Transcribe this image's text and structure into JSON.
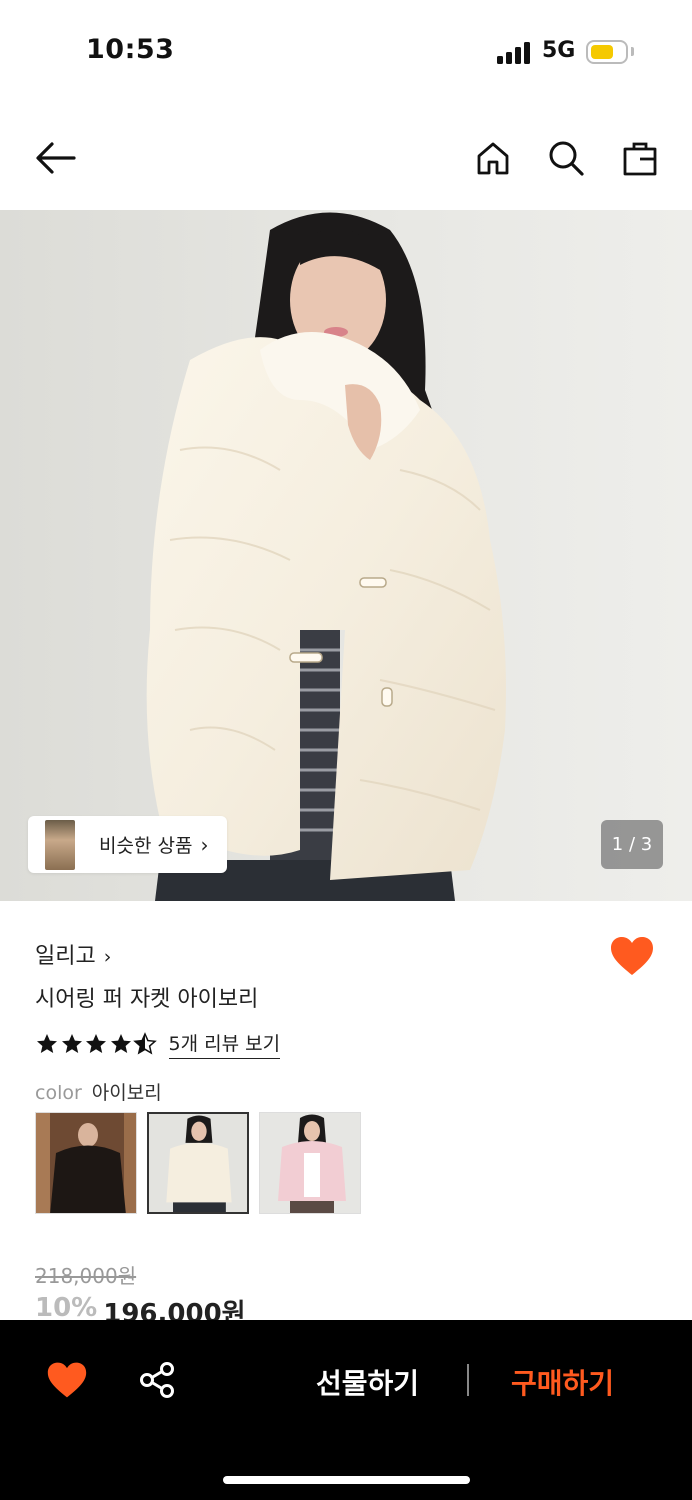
{
  "status_bar": {
    "time": "10:53",
    "network": "5G"
  },
  "nav": {
    "back_icon": "arrow-left-icon",
    "home_icon": "home-icon",
    "search_icon": "search-icon",
    "bag_icon": "shopping-bag-icon"
  },
  "hero": {
    "similar_products_label": "비슷한 상품",
    "similar_arrow": "›",
    "image_counter": "1 / 3"
  },
  "product": {
    "brand": "일리고",
    "brand_arrow": "›",
    "title": "시어링 퍼 자켓 아이보리",
    "rating": 4.5,
    "review_link": "5개 리뷰 보기",
    "color_label": "color",
    "color_value": "아이보리",
    "swatches": [
      "black",
      "ivory",
      "pink"
    ],
    "selected_swatch": "ivory",
    "original_price": "218,000원",
    "discount": "10%",
    "sale_price": "196,000원",
    "liked": true
  },
  "bottom_bar": {
    "gift_label": "선물하기",
    "buy_label": "구매하기"
  },
  "colors": {
    "accent": "#ff5a1f",
    "heart": "#ff5a1f",
    "bottom_bar_bg": "#000000"
  }
}
